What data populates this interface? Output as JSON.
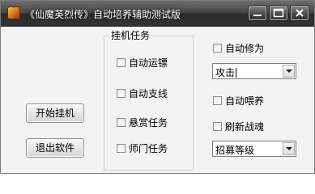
{
  "window": {
    "title": "《仙魔英烈传》自动培养辅助测试版",
    "controls": {
      "minimize": "minimize-icon",
      "maximize": "maximize-icon",
      "close": "close-icon"
    }
  },
  "left_buttons": {
    "start": "开始挂机",
    "exit": "退出软件"
  },
  "group": {
    "title": "挂机任务",
    "items": [
      "自动运镖",
      "自动支线",
      "悬赏任务",
      "师门任务"
    ]
  },
  "right": {
    "auto_cultivate": "自动修为",
    "attack_select": "攻击",
    "auto_feed": "自动喂养",
    "refresh_soul": "刷新战魂",
    "recruit_select": "招募等级"
  }
}
